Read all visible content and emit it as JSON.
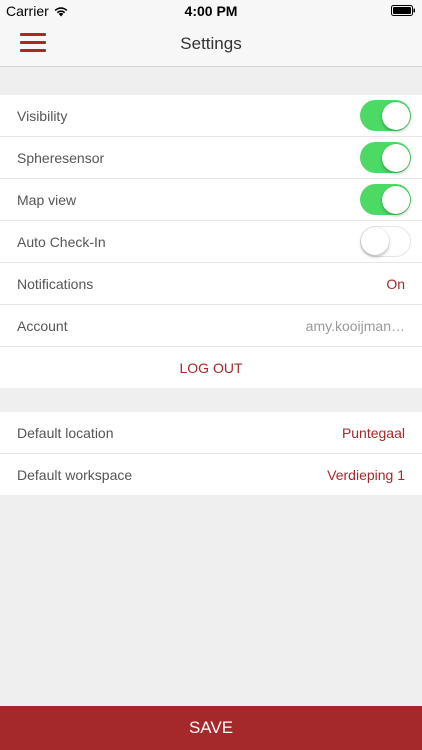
{
  "status_bar": {
    "carrier": "Carrier",
    "time": "4:00 PM"
  },
  "nav": {
    "title": "Settings"
  },
  "settings": {
    "visibility": {
      "label": "Visibility",
      "enabled": true
    },
    "spheresensor": {
      "label": "Spheresensor",
      "enabled": true
    },
    "map_view": {
      "label": "Map view",
      "enabled": true
    },
    "auto_checkin": {
      "label": "Auto Check-In",
      "enabled": false
    },
    "notifications": {
      "label": "Notifications",
      "value": "On"
    },
    "account": {
      "label": "Account",
      "value": "amy.kooijman…"
    },
    "logout_label": "LOG OUT"
  },
  "defaults": {
    "location": {
      "label": "Default location",
      "value": "Puntegaal"
    },
    "workspace": {
      "label": "Default workspace",
      "value": "Verdieping 1"
    }
  },
  "save_label": "SAVE",
  "colors": {
    "accent": "#a5282b",
    "toggle_on": "#4cd964"
  }
}
